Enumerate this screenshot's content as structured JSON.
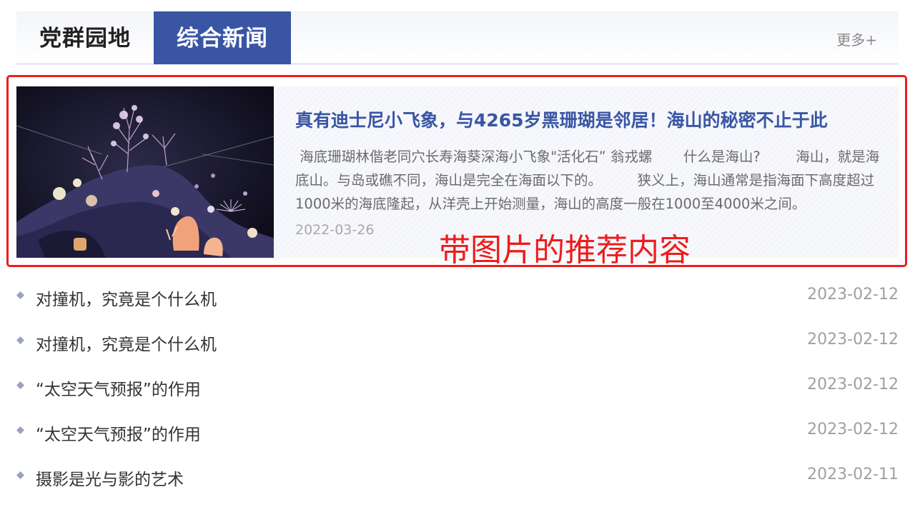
{
  "tabs": [
    {
      "label": "党群园地",
      "active": false
    },
    {
      "label": "综合新闻",
      "active": true
    }
  ],
  "more_label": "更多+",
  "featured": {
    "title": "真有迪士尼小飞象，与4265岁黑珊瑚是邻居！海山的秘密不止于此",
    "summary": " 海底珊瑚林偕老同穴长寿海葵深海小飞象\"活化石” 翁戎螺       什么是海山?        海山，就是海底山。与岛或礁不同，海山是完全在海面以下的。        狭义上，海山通常是指海面下高度超过1000米的海底隆起，从洋壳上开始测量，海山的高度一般在1000至4000米之间。",
    "date": "2022-03-26",
    "image": "deep-sea-coral-photo"
  },
  "annotation": {
    "label": "带图片的推荐内容",
    "color": "#ee1c1c"
  },
  "news": [
    {
      "title": "对撞机，究竟是个什么机",
      "date": "2023-02-12"
    },
    {
      "title": "对撞机，究竟是个什么机",
      "date": "2023-02-12"
    },
    {
      "title": "“太空天气预报”的作用",
      "date": "2023-02-12"
    },
    {
      "title": "“太空天气预报”的作用",
      "date": "2023-02-12"
    },
    {
      "title": "摄影是光与影的艺术",
      "date": "2023-02-11"
    }
  ],
  "colors": {
    "accent": "#3a55a4",
    "annotation": "#ee1c1c"
  }
}
